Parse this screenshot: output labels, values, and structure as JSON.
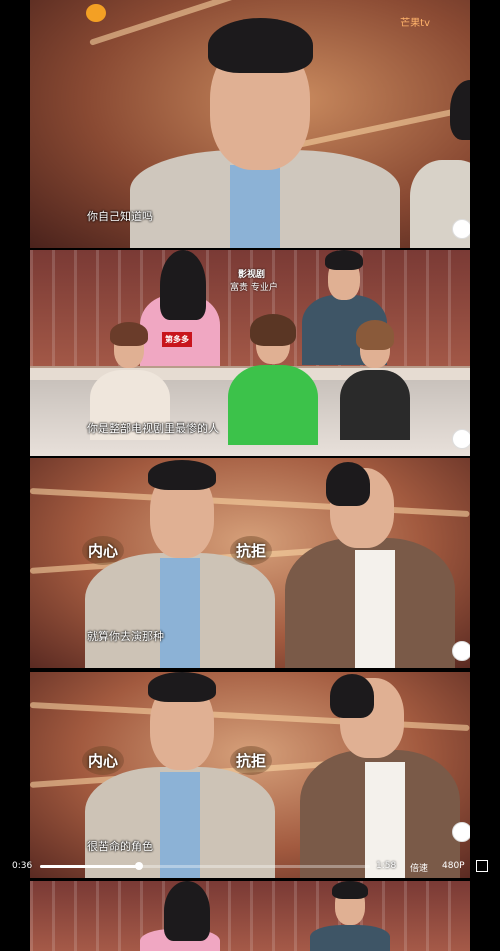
{
  "frame1": {
    "subtitle": "你自己知道吗",
    "watermark": "芒果tv"
  },
  "frame2": {
    "subtitle": "你是整部电视剧里最惨的人",
    "stage_text_top": "影视剧",
    "stage_text_sub": "富贵 专业户",
    "sign_label": "第多多"
  },
  "frame3": {
    "subtitle": "就算你去演那种",
    "badge_left": "内心",
    "badge_right": "抗拒"
  },
  "frame4": {
    "subtitle": "很苦命的角色",
    "badge_left": "内心",
    "badge_right": "抗拒"
  },
  "player": {
    "current_time": "0:36",
    "total_time": "1:58",
    "speed_label": "倍速",
    "quality_label": "480P",
    "progress": 0.3
  },
  "colors": {
    "accent": "#f39a1e"
  }
}
